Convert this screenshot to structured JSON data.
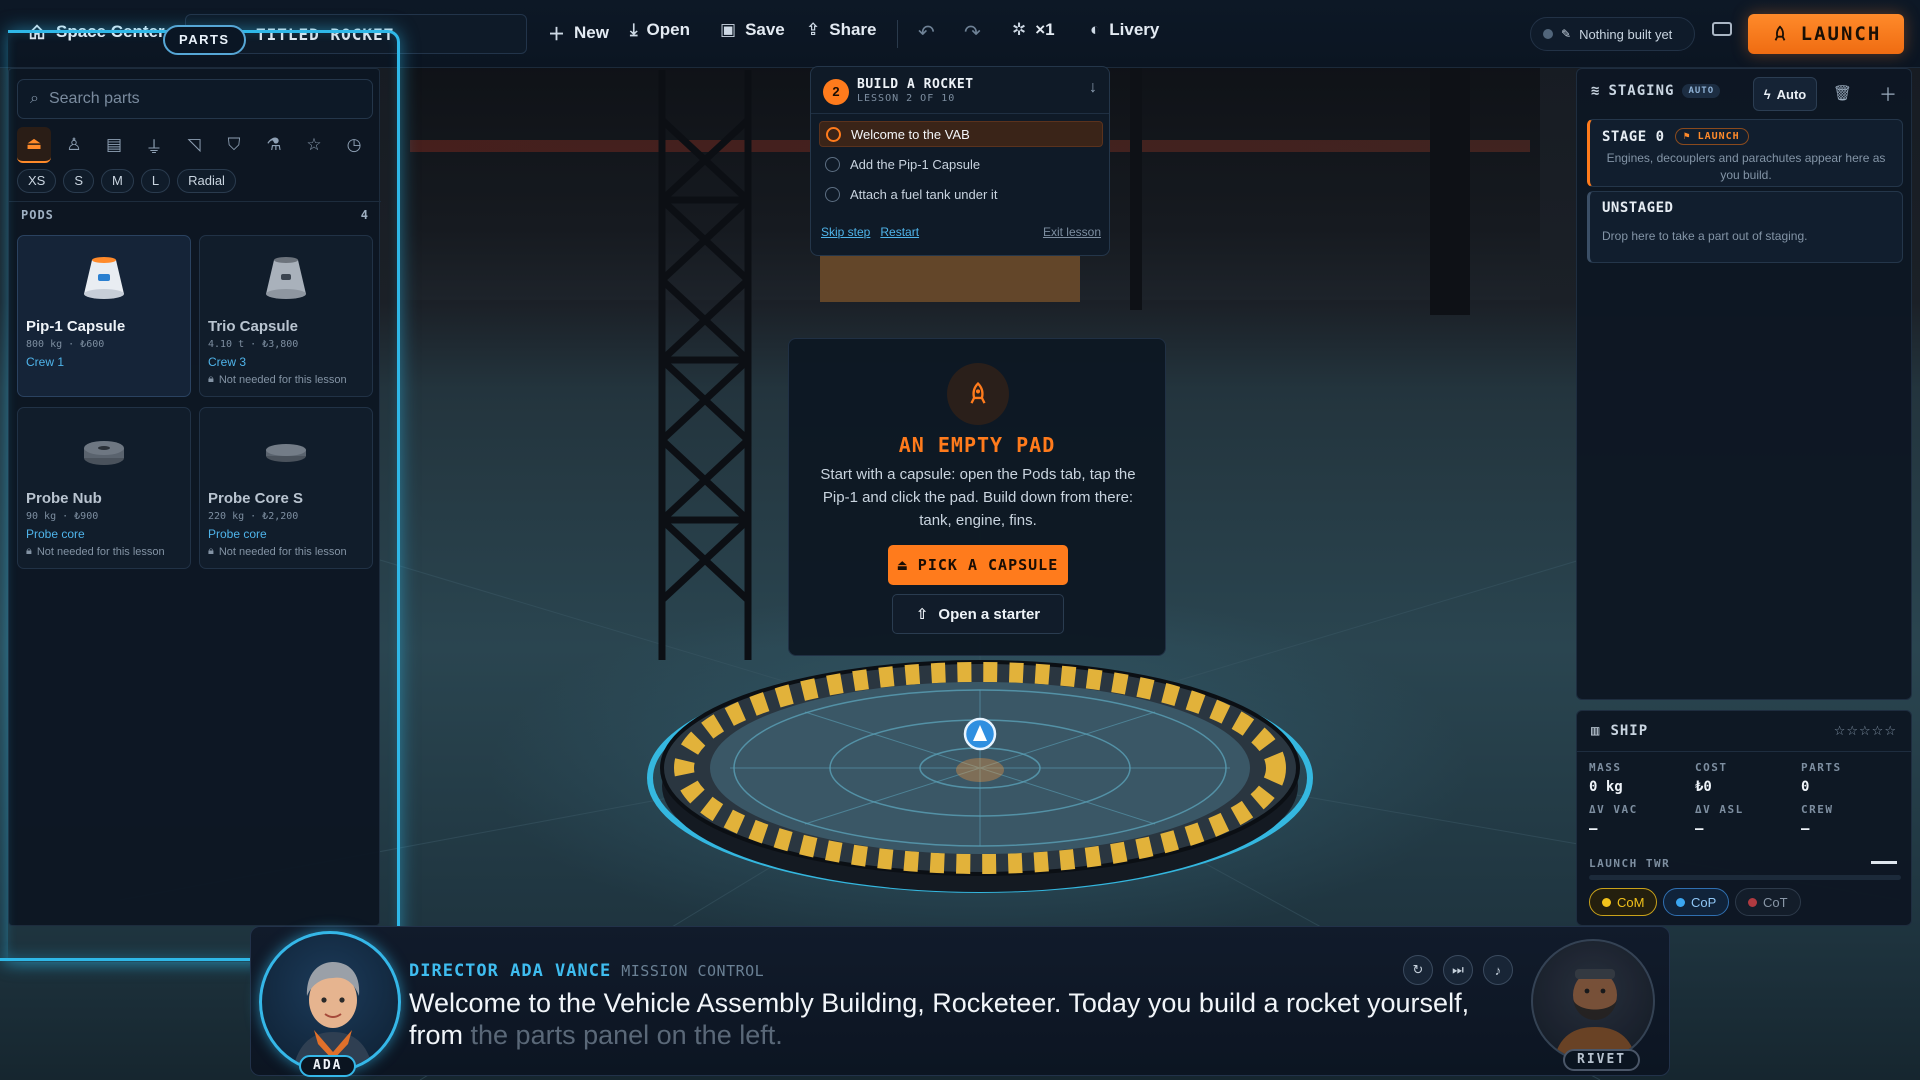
{
  "topbar": {
    "home_label": "Space Center",
    "parts_chip": "PARTS",
    "rocket_title": "TITLED ROCKET",
    "new_label": "New",
    "open_label": "Open",
    "save_label": "Save",
    "share_label": "Share",
    "symmetry_label": "×1",
    "livery_label": "Livery",
    "status_text": "Nothing built yet",
    "launch_label": "LAUNCH"
  },
  "parts_panel": {
    "search_placeholder": "Search parts",
    "categories": [
      "pods-icon",
      "engines-icon",
      "tanks-icon",
      "decouplers-icon",
      "fins-icon",
      "parachutes-icon",
      "science-icon",
      "favorites-icon",
      "recent-icon"
    ],
    "sizes": [
      "XS",
      "S",
      "M",
      "L",
      "Radial"
    ],
    "section_title": "PODS",
    "section_count": "4",
    "parts": [
      {
        "name": "Pip-1 Capsule",
        "meta": "800 kg · ₺600",
        "sub": "Crew 1",
        "note": ""
      },
      {
        "name": "Trio Capsule",
        "meta": "4.10 t · ₺3,800",
        "sub": "Crew 3",
        "note": "Not needed for this lesson"
      },
      {
        "name": "Probe Nub",
        "meta": "90 kg · ₺900",
        "sub": "Probe core",
        "note": "Not needed for this lesson"
      },
      {
        "name": "Probe Core S",
        "meta": "220 kg · ₺2,200",
        "sub": "Probe core",
        "note": "Not needed for this lesson"
      }
    ]
  },
  "lesson": {
    "number": "2",
    "title": "BUILD A ROCKET",
    "subtitle": "LESSON 2 OF 10",
    "steps": [
      "Welcome to the VAB",
      "Add the Pip-1 Capsule",
      "Attach a fuel tank under it"
    ],
    "skip": "Skip step",
    "restart": "Restart",
    "exit": "Exit lesson"
  },
  "empty_pad": {
    "title": "AN EMPTY PAD",
    "body": "Start with a capsule: open the Pods tab, tap the Pip-1 and click the pad. Build down from there: tank, engine, fins.",
    "primary": "PICK A CAPSULE",
    "secondary": "Open a starter"
  },
  "staging": {
    "title": "STAGING",
    "auto_tag": "AUTO",
    "auto_button": "Auto",
    "stage0_title": "STAGE 0",
    "stage0_badge": "LAUNCH",
    "stage0_desc": "Engines, decouplers and parachutes appear here as you build.",
    "unstaged_title": "UNSTAGED",
    "unstaged_desc": "Drop here to take a part out of staging."
  },
  "ship": {
    "title": "SHIP",
    "rating_stars": 0,
    "stats": [
      {
        "label": "MASS",
        "value": "0 kg"
      },
      {
        "label": "COST",
        "value": "₺0"
      },
      {
        "label": "PARTS",
        "value": "0"
      },
      {
        "label": "ΔV VAC",
        "value": "—"
      },
      {
        "label": "ΔV ASL",
        "value": "—"
      },
      {
        "label": "CREW",
        "value": "—"
      }
    ],
    "twr_label": "LAUNCH TWR",
    "chips": [
      {
        "label": "CoM",
        "color": "#f2c21b"
      },
      {
        "label": "CoP",
        "color": "#3ba6f0"
      },
      {
        "label": "CoT",
        "color": "#e0444a"
      }
    ]
  },
  "dialog": {
    "speaker": "DIRECTOR ADA VANCE",
    "role": "MISSION CONTROL",
    "line_main": "Welcome to the Vehicle Assembly Building, Rocketeer. Today you build a rocket yourself, from",
    "line_fade": "the parts panel on the left.",
    "left_tag": "ADA",
    "right_tag": "RIVET"
  },
  "colors": {
    "accent": "#ff7b1c",
    "highlight": "#2fb8e8",
    "link": "#4fb4ea"
  }
}
